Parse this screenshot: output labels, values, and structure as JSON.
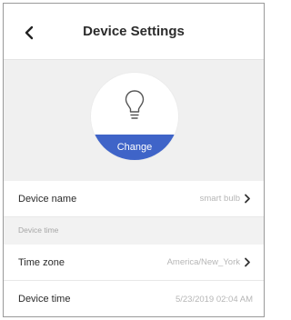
{
  "header": {
    "title": "Device Settings"
  },
  "hero": {
    "change_label": "Change"
  },
  "rows": {
    "device_name": {
      "label": "Device name",
      "value": "smart bulb"
    },
    "section_device_time": "Device time",
    "time_zone": {
      "label": "Time zone",
      "value": "America/New_York"
    },
    "device_time": {
      "label": "Device time",
      "value": "5/23/2019 02:04 AM"
    }
  },
  "icons": {
    "back": "chevron-left-icon",
    "bulb": "lightbulb-icon",
    "chevron": "chevron-right-icon"
  },
  "colors": {
    "accent": "#3f64c8",
    "background": "#f0f0f0"
  }
}
